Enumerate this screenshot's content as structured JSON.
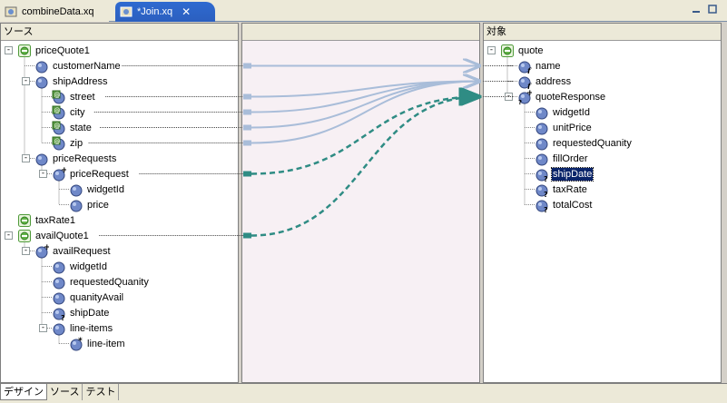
{
  "tabs": [
    {
      "label": "combineData.xq",
      "active": false
    },
    {
      "label": "*Join.xq",
      "active": true
    }
  ],
  "panes": {
    "source_title": "ソース",
    "target_title": "対象"
  },
  "source_tree": [
    {
      "label": "priceQuote1",
      "icon": "schema-root-icon",
      "indent": 0,
      "expander": "-"
    },
    {
      "label": "customerName",
      "icon": "element-icon",
      "indent": 1
    },
    {
      "label": "shipAddress",
      "icon": "element-icon",
      "indent": 1,
      "expander": "-"
    },
    {
      "label": "street",
      "icon": "attribute-icon",
      "indent": 2
    },
    {
      "label": "city",
      "icon": "attribute-icon",
      "indent": 2
    },
    {
      "label": "state",
      "icon": "attribute-icon",
      "indent": 2
    },
    {
      "label": "zip",
      "icon": "attribute-icon",
      "indent": 2
    },
    {
      "label": "priceRequests",
      "icon": "element-icon",
      "indent": 1,
      "expander": "-"
    },
    {
      "label": "priceRequest",
      "icon": "repeating-element-icon",
      "indent": 2,
      "expander": "-"
    },
    {
      "label": "widgetId",
      "icon": "element-icon",
      "indent": 3
    },
    {
      "label": "price",
      "icon": "element-icon",
      "indent": 3
    },
    {
      "label": "taxRate1",
      "icon": "schema-root-icon",
      "indent": 0
    },
    {
      "label": "availQuote1",
      "icon": "schema-root-icon",
      "indent": 0,
      "expander": "-"
    },
    {
      "label": "availRequest",
      "icon": "repeating-element-icon",
      "indent": 1,
      "expander": "-"
    },
    {
      "label": "widgetId",
      "icon": "element-icon",
      "indent": 2
    },
    {
      "label": "requestedQuanity",
      "icon": "element-icon",
      "indent": 2
    },
    {
      "label": "quanityAvail",
      "icon": "element-icon",
      "indent": 2
    },
    {
      "label": "shipDate",
      "icon": "optional-element-icon",
      "indent": 2
    },
    {
      "label": "line-items",
      "icon": "element-icon",
      "indent": 2,
      "expander": "-"
    },
    {
      "label": "line-item",
      "icon": "repeating-any-element-icon",
      "indent": 3
    }
  ],
  "target_tree": [
    {
      "label": "quote",
      "icon": "schema-root-icon",
      "indent": 0,
      "expander": "-"
    },
    {
      "label": "name",
      "icon": "function-element-icon",
      "indent": 1
    },
    {
      "label": "address",
      "icon": "function-element-icon",
      "indent": 1
    },
    {
      "label": "quoteResponse",
      "icon": "repeating-optional-element-icon",
      "indent": 1,
      "expander": "-"
    },
    {
      "label": "widgetId",
      "icon": "element-icon",
      "indent": 2
    },
    {
      "label": "unitPrice",
      "icon": "element-icon",
      "indent": 2
    },
    {
      "label": "requestedQuanity",
      "icon": "element-icon",
      "indent": 2
    },
    {
      "label": "fillOrder",
      "icon": "element-icon",
      "indent": 2
    },
    {
      "label": "shipDate",
      "icon": "optional-element-icon",
      "indent": 2,
      "selected": true
    },
    {
      "label": "taxRate",
      "icon": "optional-element-icon",
      "indent": 2
    },
    {
      "label": "totalCost",
      "icon": "optional-element-icon",
      "indent": 2
    }
  ],
  "mappings": [
    {
      "from": "customerName",
      "to": "name",
      "style": "solid"
    },
    {
      "from": "street",
      "to": "address",
      "style": "solid"
    },
    {
      "from": "city",
      "to": "address",
      "style": "solid"
    },
    {
      "from": "state",
      "to": "address",
      "style": "solid"
    },
    {
      "from": "zip",
      "to": "address",
      "style": "solid"
    },
    {
      "from": "priceRequest",
      "to": "quoteResponse",
      "style": "dashed"
    },
    {
      "from": "availQuote1",
      "to": "quoteResponse",
      "style": "dashed"
    }
  ],
  "bottom_tabs": [
    {
      "label": "デザイン",
      "active": true
    },
    {
      "label": "ソース",
      "active": false
    },
    {
      "label": "テスト",
      "active": false
    }
  ],
  "colors": {
    "solid_link": "#a9bdd9",
    "dashed_link": "#2f8c84",
    "tab_active": "#2f6ad0",
    "selection": "#0a246a"
  }
}
